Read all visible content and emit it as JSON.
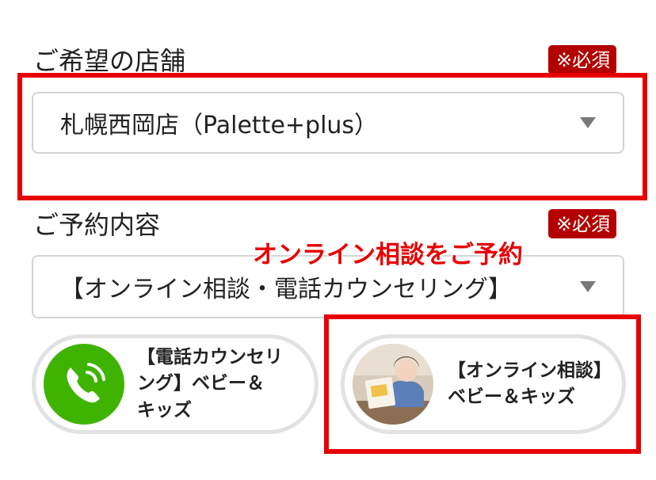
{
  "store": {
    "label": "ご希望の店舗",
    "required_badge": "※必須",
    "selected": "札幌西岡店（Palette+plus）"
  },
  "reservation": {
    "label": "ご予約内容",
    "required_badge": "※必須",
    "selected": "【オンライン相談・電話カウンセリング】"
  },
  "annotation": "オンライン相談をご予約",
  "options": [
    {
      "text": "【電話カウンセリ\nング】ベビー＆\nキッズ",
      "icon": "phone-icon"
    },
    {
      "text": "【オンライン相談】\nベビー＆キッズ",
      "icon": "photo-thumbnail"
    }
  ],
  "colors": {
    "badge": "#b30000",
    "highlight_red": "#e60000",
    "phone_green": "#3fb400"
  }
}
